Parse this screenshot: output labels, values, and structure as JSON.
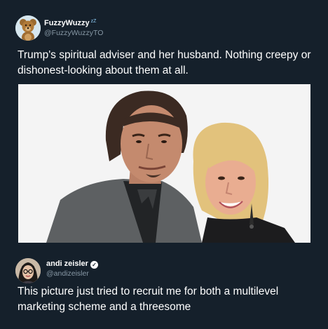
{
  "tweets": [
    {
      "display_name": "FuzzyWuzzy",
      "name_badge": "zZ",
      "handle": "@FuzzyWuzzyTO",
      "text": "Trump's spiritual adviser and her husband. Nothing creepy or dishonest-looking about them at all.",
      "avatar_icon": "teddy-bear-icon"
    },
    {
      "display_name": "andi zeisler",
      "verified": true,
      "handle": "@andizeisler",
      "text": "This picture just tried to recruit me for both a multilevel marketing scheme and a threesome",
      "avatar_icon": "user-avatar"
    }
  ],
  "colors": {
    "background": "#15202b",
    "text": "#ffffff",
    "handle": "#8899a6",
    "sleep_badge": "#8ecdf8"
  }
}
